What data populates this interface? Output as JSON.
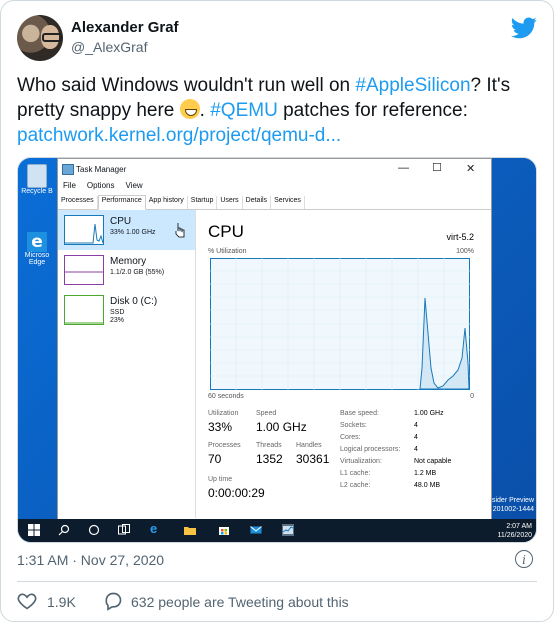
{
  "author": {
    "name": "Alexander Graf",
    "handle": "@_AlexGraf"
  },
  "tweet": {
    "part1": "Who said Windows wouldn't run well on ",
    "tag1": "#AppleSilicon",
    "part2": "? It's pretty snappy here ",
    "part3": ". ",
    "tag2": "#QEMU",
    "part4": " patches for reference: ",
    "link": "patchwork.kernel.org/project/qemu-d..."
  },
  "screenshot": {
    "desktop": {
      "recycle_bin": "Recycle B",
      "edge_label1": "Microso",
      "edge_label2": "Edge",
      "preview1": "sider Preview",
      "preview2": "201002-1444"
    },
    "task_manager": {
      "title": "Task Manager",
      "menu": [
        "File",
        "Options",
        "View"
      ],
      "tabs": [
        "Processes",
        "Performance",
        "App history",
        "Startup",
        "Users",
        "Details",
        "Services"
      ],
      "resources": [
        {
          "name": "CPU",
          "sub": "33% 1.00 GHz",
          "sub2": ""
        },
        {
          "name": "Memory",
          "sub": "1.1/2.0 GB (55%)",
          "sub2": ""
        },
        {
          "name": "Disk 0 (C:)",
          "sub": "SSD",
          "sub2": "23%"
        }
      ],
      "cpu_title": "CPU",
      "cpu_model": "virt-5.2",
      "util_label": "% Utilization",
      "util_max": "100%",
      "time_label": "60 seconds",
      "time_end": "0",
      "stats": {
        "utilization_label": "Utilization",
        "utilization": "33%",
        "speed_label": "Speed",
        "speed": "1.00 GHz",
        "processes_label": "Processes",
        "processes": "70",
        "threads_label": "Threads",
        "threads": "1352",
        "handles_label": "Handles",
        "handles": "30361",
        "uptime_label": "Up time",
        "uptime": "0:00:00:29"
      },
      "details": [
        {
          "k": "Base speed:",
          "v": "1.00 GHz"
        },
        {
          "k": "Sockets:",
          "v": "4"
        },
        {
          "k": "Cores:",
          "v": "4"
        },
        {
          "k": "Logical processors:",
          "v": "4"
        },
        {
          "k": "Virtualization:",
          "v": "Not capable"
        },
        {
          "k": "L1 cache:",
          "v": "1.2 MB"
        },
        {
          "k": "L2 cache:",
          "v": "48.0 MB"
        }
      ]
    },
    "taskbar": {
      "time": "2:07 AM",
      "date": "11/26/2020",
      "notifications": "2"
    }
  },
  "meta": {
    "timestamp": "1:31 AM · Nov 27, 2020"
  },
  "actions": {
    "likes": "1.9K",
    "replies": "632 people are Tweeting about this"
  },
  "colors": {
    "link": "#1d9bf0",
    "like": "#f91880"
  }
}
